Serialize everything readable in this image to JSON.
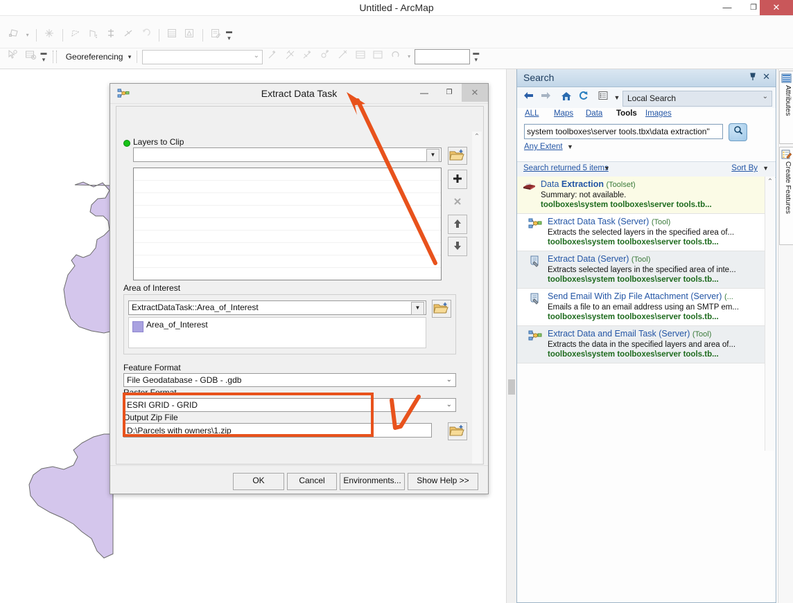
{
  "window": {
    "title": "Untitled - ArcMap",
    "minimize": "—",
    "maximize": "❐",
    "close": "✕"
  },
  "toolbars": {
    "georeferencing_menu": "Georeferencing",
    "georef_dropdown_value": "",
    "rotation_box_value": "",
    "row1_icons": [
      "editor-polygon-icon",
      "sketch-icon",
      "trace-icon",
      "split-icon",
      "intersect-icon",
      "construct-icon",
      "undo-arc-icon",
      "attribute-table-icon",
      "topology-icon",
      "edit-attributes-icon"
    ],
    "row2_icons": [
      "select-feature-icon",
      "table-clear-icon",
      "link-icon",
      "add-link-icon",
      "auto-register-icon",
      "view-link-table-icon",
      "rotate-icon"
    ]
  },
  "dialog": {
    "icon": "model-tool-icon",
    "title": "Extract Data Task",
    "minimize": "—",
    "maximize": "❐",
    "close": "✕",
    "layers_to_clip": {
      "label": "Layers to Clip",
      "combo_value": "",
      "list_items": [],
      "buttons": {
        "browse": "open-folder-icon",
        "add": "+",
        "remove": "✖",
        "up": "↑",
        "down": "↓"
      }
    },
    "area_of_interest": {
      "label": "Area of Interest",
      "combo_value": "ExtractDataTask::Area_of_Interest",
      "browse": "open-folder-icon",
      "items": [
        {
          "name": "Area_of_Interest",
          "swatch_color": "#a9a2e0"
        }
      ]
    },
    "feature_format": {
      "label": "Feature Format",
      "value": "File Geodatabase - GDB - .gdb"
    },
    "raster_format": {
      "label": "Raster Format",
      "value": "ESRI GRID - GRID"
    },
    "output_zip_file": {
      "label": "Output Zip File",
      "value": "D:\\Parcels with owners\\1.zip",
      "browse": "open-folder-icon",
      "highlight_color": "#e8521c"
    },
    "footer": {
      "ok": "OK",
      "cancel": "Cancel",
      "environments": "Environments...",
      "show_help": "Show Help >>"
    }
  },
  "search_panel": {
    "title": "Search",
    "pin": "pin-icon",
    "close": "✕",
    "nav": {
      "back": "back-arrow-icon",
      "forward": "forward-arrow-icon",
      "home": "home-icon",
      "refresh": "refresh-icon",
      "list": "list-view-icon",
      "list_arrow": "▼"
    },
    "scope": {
      "value": "Local Search",
      "chevron": "⌄"
    },
    "tabs": [
      {
        "label": "ALL",
        "active": false
      },
      {
        "label": "Maps",
        "active": false
      },
      {
        "label": "Data",
        "active": false
      },
      {
        "label": "Tools",
        "active": true
      },
      {
        "label": "Images",
        "active": false
      }
    ],
    "query": "system toolboxes\\server tools.tbx\\data extraction\"",
    "search_button": "search-icon",
    "extent_filter": "Any Extent",
    "extent_arrow": "▼",
    "result_count": "Search returned 5 items",
    "result_count_arrow": "▼",
    "sort_by": "Sort By",
    "sort_by_arrow": "▼",
    "results": [
      {
        "icon": "toolset-icon",
        "title_plain": "Data ",
        "title_bold": "Extraction",
        "kind": "(Toolset)",
        "summary": "Summary: not available.",
        "path": "toolboxes\\system toolboxes\\server tools.tb...",
        "highlight": "yellow",
        "indent": false
      },
      {
        "icon": "model-tool-icon",
        "title_plain": "Extract Data Task (Server)",
        "title_bold": "",
        "kind": "(Tool)",
        "summary": "Extracts the selected layers in the specified area of...",
        "path": "toolboxes\\system toolboxes\\server tools.tb...",
        "highlight": "plain",
        "indent": true
      },
      {
        "icon": "script-tool-icon",
        "title_plain": "Extract Data (Server)",
        "title_bold": "",
        "kind": "(Tool)",
        "summary": "Extracts selected layers in the specified area of inte...",
        "path": "toolboxes\\system toolboxes\\server tools.tb...",
        "highlight": "gray",
        "indent": true
      },
      {
        "icon": "script-tool-icon",
        "title_plain": "Send Email With Zip File Attachment (Server)",
        "title_bold": "",
        "kind": "(...",
        "summary": "Emails a file to an email address using an SMTP em...",
        "path": "toolboxes\\system toolboxes\\server tools.tb...",
        "highlight": "plain",
        "indent": true
      },
      {
        "icon": "model-tool-icon",
        "title_plain": "Extract Data and Email Task (Server)",
        "title_bold": "",
        "kind": "(Tool)",
        "summary": "Extracts the data in the specified layers and area of...",
        "path": "toolboxes\\system toolboxes\\server tools.tb...",
        "highlight": "gray",
        "indent": true
      }
    ],
    "scroll_up": "⌃"
  },
  "dock_tabs": [
    {
      "label": "Attributes",
      "icon": "table-icon"
    },
    {
      "label": "Create Features",
      "icon": "create-features-icon"
    }
  ],
  "map": {
    "polygon_fill": "#d4c6ec",
    "polygon_stroke": "#6b6b6b"
  },
  "annotations": {
    "arrow_color": "#e8521c",
    "highlight_color": "#e8521c"
  }
}
